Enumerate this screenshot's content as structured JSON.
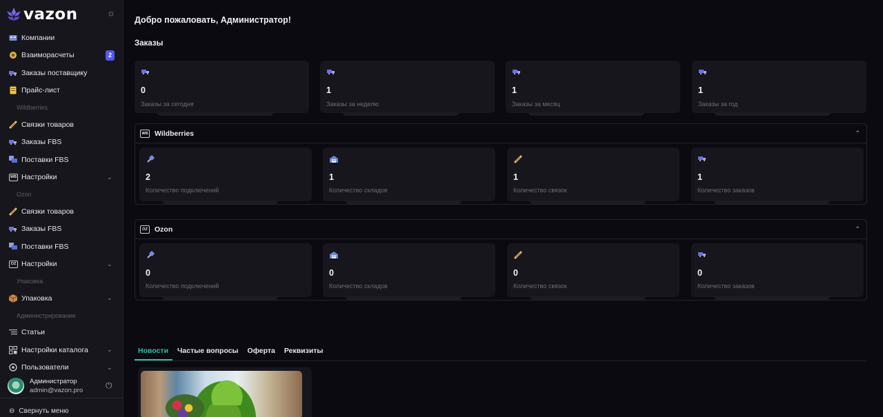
{
  "brand": {
    "name": "vazon"
  },
  "sidebar": {
    "items": [
      {
        "label": "Компании",
        "icon": "building-icon"
      },
      {
        "label": "Взаиморасчеты",
        "icon": "coins-icon",
        "badge": "2"
      },
      {
        "label": "Заказы поставщику",
        "icon": "truck-icon"
      },
      {
        "label": "Прайс-лист",
        "icon": "price-list-icon"
      }
    ],
    "section_wb": "Wildberries",
    "wb_items": [
      {
        "label": "Связки товаров",
        "icon": "link-icon"
      },
      {
        "label": "Заказы FBS",
        "icon": "truck-icon"
      },
      {
        "label": "Поставки FBS",
        "icon": "delivery-icon"
      },
      {
        "label": "Настройки",
        "icon": "wb-icon",
        "icon_text": "WB"
      }
    ],
    "section_ozon": "Ozon",
    "ozon_items": [
      {
        "label": "Связки товаров",
        "icon": "link-icon"
      },
      {
        "label": "Заказы FBS",
        "icon": "truck-icon"
      },
      {
        "label": "Поставки FBS",
        "icon": "delivery-icon"
      },
      {
        "label": "Настройки",
        "icon": "oz-icon",
        "icon_text": "OZ"
      }
    ],
    "section_pack": "Упаковка",
    "pack_items": [
      {
        "label": "Упаковка",
        "icon": "box-icon"
      }
    ],
    "section_admin": "Администрирование",
    "admin_items": [
      {
        "label": "Статьи",
        "icon": "articles-icon"
      },
      {
        "label": "Настройки каталога",
        "icon": "catalog-icon"
      },
      {
        "label": "Пользователи",
        "icon": "users-icon"
      }
    ],
    "user": {
      "name": "Администратор",
      "email": "admin@vazon.pro"
    },
    "collapse_label": "Свернуть меню"
  },
  "main": {
    "welcome": "Добро пожаловать, Администратор!",
    "orders_title": "Заказы",
    "order_stats": [
      {
        "value": "0",
        "label": "Заказы за сегодня"
      },
      {
        "value": "1",
        "label": "Заказы за неделю"
      },
      {
        "value": "1",
        "label": "Заказы за месяц"
      },
      {
        "value": "1",
        "label": "Заказы за год"
      }
    ],
    "wb_panel": {
      "title": "Wildberries",
      "icon_text": "WB",
      "stats": [
        {
          "value": "2",
          "label": "Количество подключений",
          "icon": "plug-icon"
        },
        {
          "value": "1",
          "label": "Количество складов",
          "icon": "warehouse-icon"
        },
        {
          "value": "1",
          "label": "Количество связок",
          "icon": "link-icon"
        },
        {
          "value": "1",
          "label": "Количество заказов",
          "icon": "truck-icon"
        }
      ]
    },
    "ozon_panel": {
      "title": "Ozon",
      "icon_text": "OZ",
      "stats": [
        {
          "value": "0",
          "label": "Количество подключений",
          "icon": "plug-icon"
        },
        {
          "value": "0",
          "label": "Количество складов",
          "icon": "warehouse-icon"
        },
        {
          "value": "0",
          "label": "Количество связок",
          "icon": "link-icon"
        },
        {
          "value": "0",
          "label": "Количество заказов",
          "icon": "truck-icon"
        }
      ]
    },
    "tabs": [
      {
        "label": "Новости",
        "active": true
      },
      {
        "label": "Частые вопросы"
      },
      {
        "label": "Оферта"
      },
      {
        "label": "Реквизиты"
      }
    ]
  },
  "colors": {
    "accent": "#2fc0a8",
    "badge": "#5558e8",
    "background": "#0a0a10",
    "sidebar": "#16161c"
  }
}
